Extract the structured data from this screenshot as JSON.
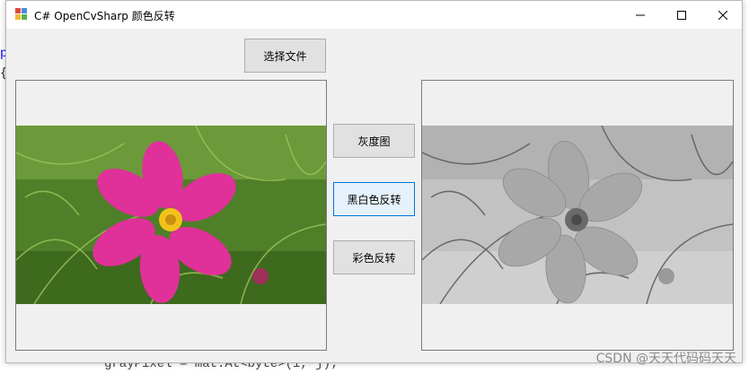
{
  "window": {
    "title": "C# OpenCvSharp 颜色反转"
  },
  "buttons": {
    "select_file": "选择文件",
    "grayscale": "灰度图",
    "bw_invert": "黑白色反转",
    "color_invert": "彩色反转"
  },
  "background_code": {
    "line_bottom": "grayPixel = mat.At<byte>(i, j);"
  },
  "watermark": "CSDN @天天代码码天天",
  "colors": {
    "accent": "#0078d7",
    "window_bg": "#f0f0f0"
  }
}
